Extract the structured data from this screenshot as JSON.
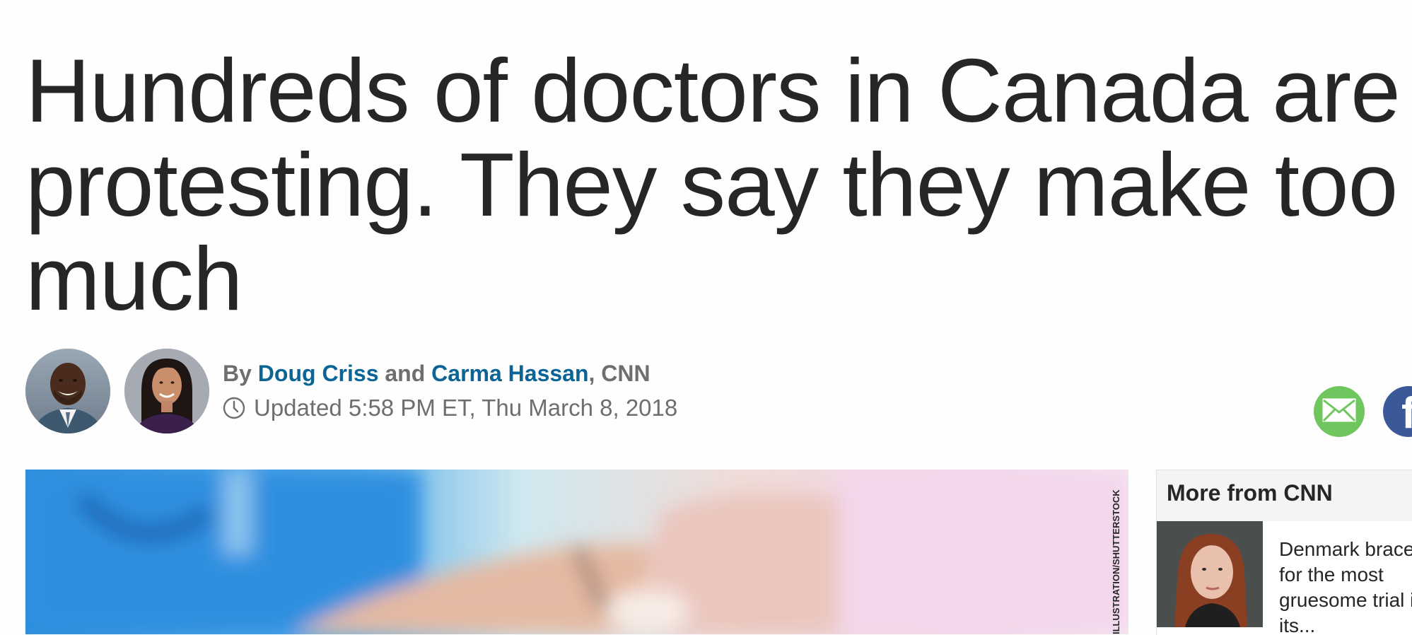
{
  "article": {
    "headline": "Hundreds of doctors in Canada are protesting. They say they make too much",
    "byline": {
      "prefix": "By",
      "authors": [
        "Doug Criss",
        "Carma Hassan"
      ],
      "conjunction": "and",
      "source": "CNN"
    },
    "timestamp": "Updated 5:58 PM ET, Thu March 8, 2018",
    "image_credit": "ILLUSTRATION/SHUTTERSTOCK"
  },
  "share": {
    "icons": [
      "envelope-icon",
      "facebook-icon"
    ]
  },
  "sidebar": {
    "title": "More from CNN",
    "items": [
      {
        "text": "Denmark braces for the most gruesome trial in its..."
      }
    ]
  },
  "colors": {
    "link": "#0c6496",
    "meta_text": "#6e6e6e",
    "headline_text": "#262626",
    "email_share": "#6fc65f",
    "facebook_share": "#3b5998"
  }
}
